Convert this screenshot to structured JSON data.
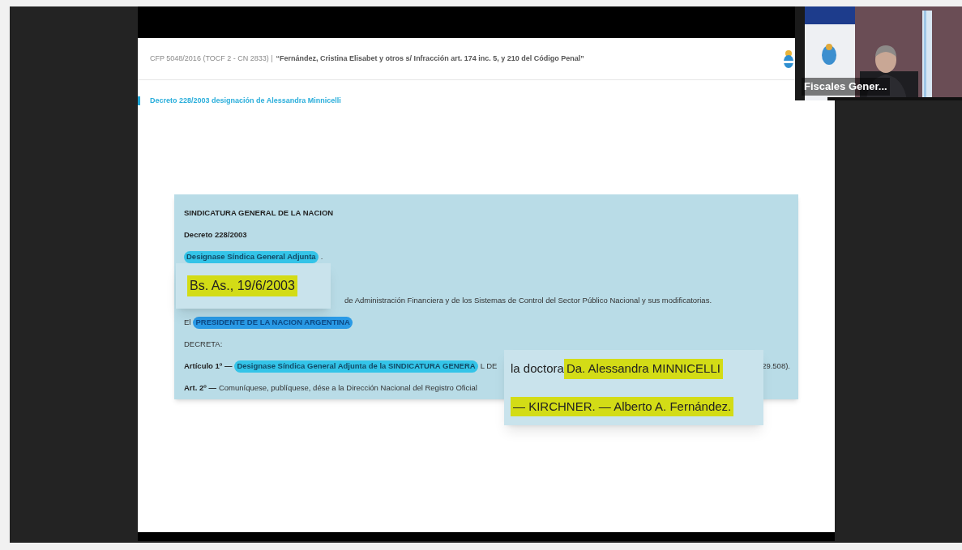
{
  "slide": {
    "case_number": "CFP 5048/2016 (TOCF 2 - CN 2833) |",
    "case_title": "“Fernández, Cristina Elisabet y otros s/ Infracción art. 174 inc. 5, y 210 del Código Penal”",
    "section_title": "Decreto 228/2003 designación de Alessandra Minnicelli",
    "document": {
      "lines": [
        {
          "kind": "normal",
          "segments": [
            {
              "text": "SINDICATURA GENERAL DE LA NACION",
              "kind": "heading"
            }
          ]
        },
        {
          "kind": "normal",
          "segments": [
            {
              "text": "Decreto 228/2003",
              "kind": "heading"
            }
          ]
        },
        {
          "kind": "normal",
          "segments": [
            {
              "text": "Designase Síndica General Adjunta",
              "kind": "marker"
            },
            {
              "text": ".",
              "kind": "body"
            }
          ]
        },
        {
          "kind": "covered_start",
          "segments": [
            {
              "text": "de Administración Financiera y de los Sistemas de Control del Sector Público Nacional y sus modificatorias.",
              "kind": "body"
            }
          ]
        },
        {
          "kind": "normal",
          "segments": [
            {
              "text": "El",
              "kind": "body"
            },
            {
              "text": "PRESIDENTE DE LA NACION ARGENTINA",
              "kind": "marker_dark"
            }
          ]
        },
        {
          "kind": "normal",
          "segments": [
            {
              "text": "DECRETA:",
              "kind": "body"
            }
          ]
        },
        {
          "kind": "split",
          "segments": [
            {
              "text": "Artículo 1º —",
              "kind": "heading"
            },
            {
              "text": "Designase Síndica General Adjunta de la SINDICATURA GENERA",
              "kind": "marker"
            },
            {
              "text": "L DE",
              "kind": "body"
            }
          ],
          "end": "29.508)."
        },
        {
          "kind": "normal",
          "segments": [
            {
              "text": "Art. 2º —",
              "kind": "heading"
            },
            {
              "text": " Comuníquese, publíquese, dése a la Dirección Nacional del Registro Oficial",
              "kind": "body"
            }
          ]
        }
      ]
    },
    "callouts": [
      {
        "kind": "date",
        "lines": [
          [
            {
              "text": "Bs. As., 19/6/2003",
              "highlighted": true
            }
          ]
        ]
      },
      {
        "kind": "signature",
        "lines": [
          [
            {
              "text": "la doctora ",
              "highlighted": false
            },
            {
              "text": "Da. Alessandra MINNICELLI",
              "highlighted": true
            }
          ],
          [
            {
              "text": "— KIRCHNER. — Alberto A. Fernández.",
              "highlighted": true
            }
          ]
        ]
      }
    ]
  },
  "video_tile": {
    "name": "Fiscales Gener..."
  }
}
